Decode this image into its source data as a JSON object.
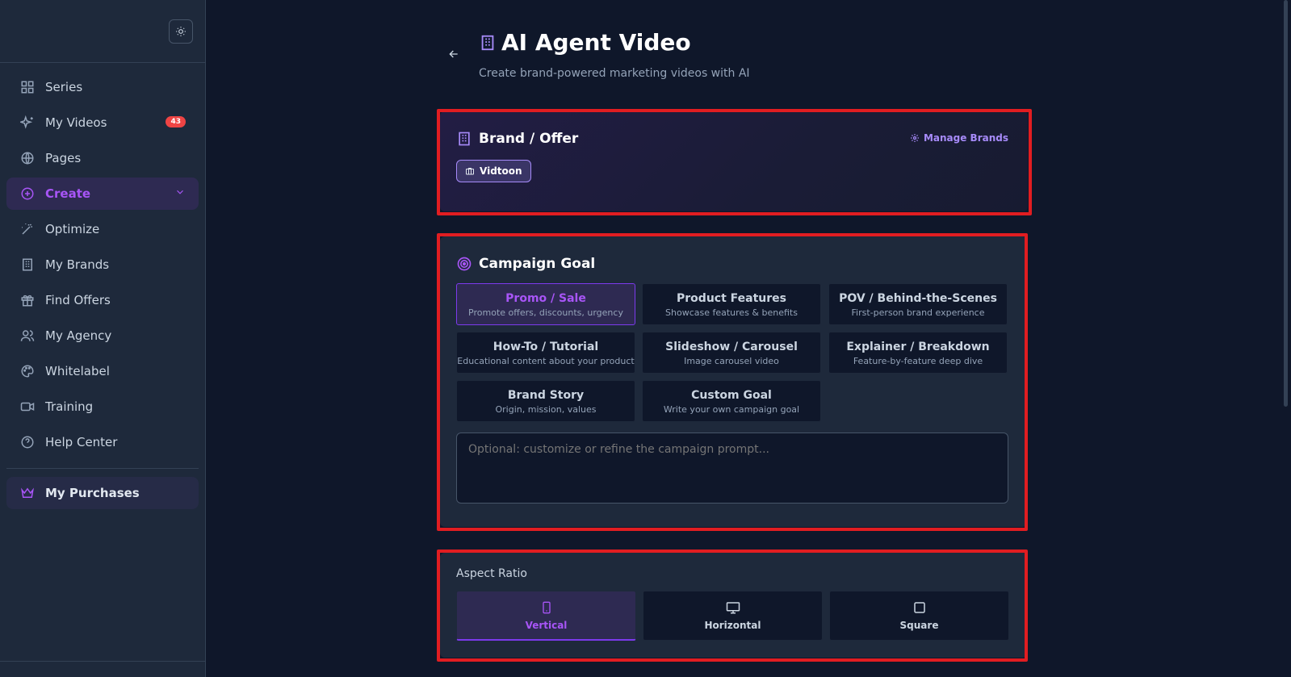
{
  "sidebar": {
    "items": [
      {
        "label": "Series",
        "icon": "grid-icon"
      },
      {
        "label": "My Videos",
        "icon": "sparkles-icon",
        "badge": "43"
      },
      {
        "label": "Pages",
        "icon": "globe-icon"
      },
      {
        "label": "Create",
        "icon": "plus-circle-icon",
        "active": true
      },
      {
        "label": "Optimize",
        "icon": "magic-wand-icon"
      },
      {
        "label": "My Brands",
        "icon": "building-icon"
      },
      {
        "label": "Find Offers",
        "icon": "gift-icon"
      },
      {
        "label": "My Agency",
        "icon": "users-icon"
      },
      {
        "label": "Whitelabel",
        "icon": "palette-icon"
      },
      {
        "label": "Training",
        "icon": "video-camera-icon"
      },
      {
        "label": "Help Center",
        "icon": "help-circle-icon"
      }
    ],
    "purchases_label": "My Purchases"
  },
  "header": {
    "title": "AI Agent Video",
    "subtitle": "Create brand-powered marketing videos with AI"
  },
  "brand": {
    "title": "Brand / Offer",
    "manage_label": "Manage Brands",
    "selected_brand": "Vidtoon"
  },
  "goal": {
    "title": "Campaign Goal",
    "options": [
      {
        "title": "Promo / Sale",
        "sub": "Promote offers, discounts, urgency",
        "selected": true
      },
      {
        "title": "Product Features",
        "sub": "Showcase features & benefits"
      },
      {
        "title": "POV / Behind-the-Scenes",
        "sub": "First-person brand experience"
      },
      {
        "title": "How-To / Tutorial",
        "sub": "Educational content about your product"
      },
      {
        "title": "Slideshow / Carousel",
        "sub": "Image carousel video"
      },
      {
        "title": "Explainer / Breakdown",
        "sub": "Feature-by-feature deep dive"
      },
      {
        "title": "Brand Story",
        "sub": "Origin, mission, values"
      },
      {
        "title": "Custom Goal",
        "sub": "Write your own campaign goal"
      }
    ],
    "prompt_placeholder": "Optional: customize or refine the campaign prompt..."
  },
  "aspect": {
    "label": "Aspect Ratio",
    "options": [
      {
        "label": "Vertical",
        "icon": "phone-icon",
        "selected": true
      },
      {
        "label": "Horizontal",
        "icon": "monitor-icon"
      },
      {
        "label": "Square",
        "icon": "square-icon"
      }
    ]
  },
  "colors": {
    "accent": "#a855f7",
    "highlight": "#e11d21",
    "badge": "#ef4444"
  }
}
